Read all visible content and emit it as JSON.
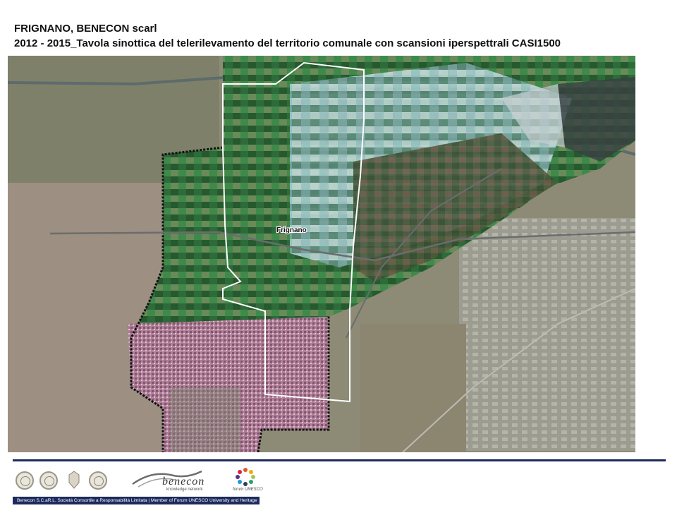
{
  "header": {
    "line1": "FRIGNANO, BENECON scarl",
    "line2": "2012 - 2015_Tavola sinottica del telerilevamento del territorio comunale con scansioni iperspettrali CASI1500"
  },
  "map": {
    "place_label": "Frignano"
  },
  "footer": {
    "benecon_word": "benecon",
    "benecon_sub": "knowledge network",
    "forum_word": "forum UNESCO",
    "bar_text": "Benecon S.C.aR.L. Società Consortile a Responsabilità Limitata | Member of Forum UNESCO University and Heritage"
  },
  "colors": {
    "divider": "#1c2a5c",
    "footer_bar": "#1c2a5c",
    "boundary": "#ffffff"
  }
}
